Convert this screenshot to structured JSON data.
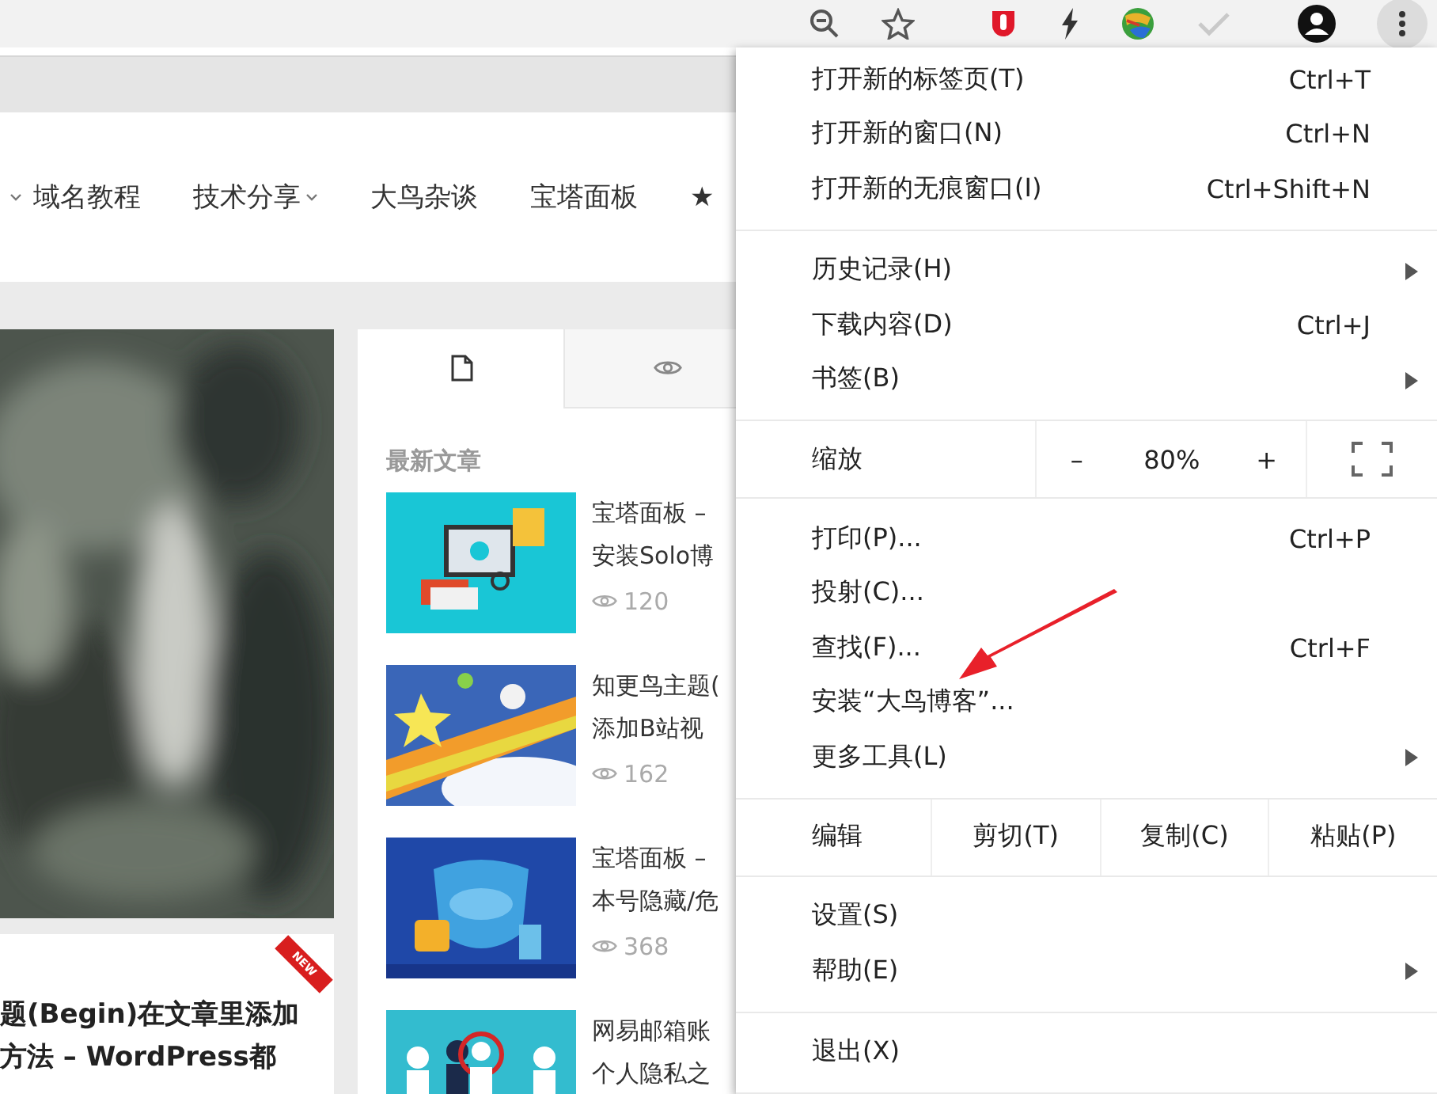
{
  "toolbar": {
    "menu_button_active": true
  },
  "nav": {
    "items": [
      {
        "label": "域名教程",
        "has_dropdown": false
      },
      {
        "label": "技术分享",
        "has_dropdown": true
      },
      {
        "label": "大鸟杂谈",
        "has_dropdown": false
      },
      {
        "label": "宝塔面板",
        "has_dropdown": false
      },
      {
        "label": "★",
        "has_dropdown": false
      }
    ]
  },
  "featured": {
    "kind": "picture",
    "title_lines": [
      "题(Begin)在文章里添加",
      "方法 – WordPress都"
    ],
    "badge": "NEW"
  },
  "sidebar": {
    "tabs": [
      {
        "kind": "document",
        "selected": true
      },
      {
        "kind": "views",
        "selected": false
      }
    ],
    "heading": "最新文章",
    "posts": [
      {
        "title_lines": [
          "宝塔面板 –",
          "安装Solo博"
        ],
        "views": "120"
      },
      {
        "title_lines": [
          "知更鸟主题(",
          "添加B站视"
        ],
        "views": "162"
      },
      {
        "title_lines": [
          "宝塔面板 –",
          "本号隐藏/危"
        ],
        "views": "368"
      },
      {
        "title_lines": [
          "网易邮箱账",
          "个人隐私之"
        ]
      }
    ]
  },
  "menu": {
    "sections": [
      [
        {
          "kind": "item",
          "label": "打开新的标签页(T)",
          "shortcut": "Ctrl+T",
          "submenu": false
        },
        {
          "kind": "item",
          "label": "打开新的窗口(N)",
          "shortcut": "Ctrl+N",
          "submenu": false
        },
        {
          "kind": "item",
          "label": "打开新的无痕窗口(I)",
          "shortcut": "Ctrl+Shift+N",
          "submenu": false
        }
      ],
      [
        {
          "kind": "item",
          "label": "历史记录(H)",
          "submenu": true
        },
        {
          "kind": "item",
          "label": "下载内容(D)",
          "shortcut": "Ctrl+J",
          "submenu": false
        },
        {
          "kind": "item",
          "label": "书签(B)",
          "submenu": true
        }
      ],
      [
        {
          "kind": "zoom",
          "label": "缩放",
          "minus": "–",
          "value": "80%",
          "plus": "+"
        }
      ],
      [
        {
          "kind": "item",
          "label": "打印(P)...",
          "shortcut": "Ctrl+P",
          "submenu": false
        },
        {
          "kind": "item",
          "label": "投射(C)...",
          "submenu": false
        },
        {
          "kind": "item",
          "label": "查找(F)...",
          "shortcut": "Ctrl+F",
          "submenu": false
        },
        {
          "kind": "item",
          "label": "安装“大鸟博客”...",
          "submenu": false
        },
        {
          "kind": "item",
          "label": "更多工具(L)",
          "submenu": true
        }
      ],
      [
        {
          "kind": "edit",
          "label": "编辑",
          "actions": [
            "剪切(T)",
            "复制(C)",
            "粘贴(P)"
          ]
        }
      ],
      [
        {
          "kind": "item",
          "label": "设置(S)",
          "submenu": false
        },
        {
          "kind": "item",
          "label": "帮助(E)",
          "submenu": true
        }
      ],
      [
        {
          "kind": "item",
          "label": "退出(X)",
          "submenu": false
        }
      ]
    ]
  }
}
